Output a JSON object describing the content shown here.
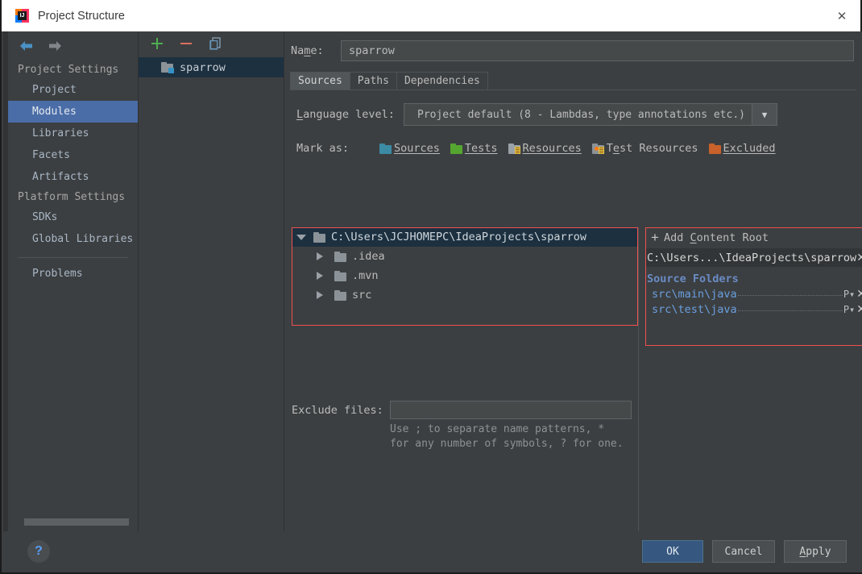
{
  "window": {
    "title": "Project Structure",
    "close_label": "✕",
    "app_icon_letter": "IJ"
  },
  "nav": {
    "back_icon": "arrow-left-icon",
    "forward_icon": "arrow-right-icon"
  },
  "sidebar": {
    "sections": [
      {
        "header": "Project Settings",
        "items": [
          {
            "label": "Project",
            "selected": false
          },
          {
            "label": "Modules",
            "selected": true
          },
          {
            "label": "Libraries",
            "selected": false
          },
          {
            "label": "Facets",
            "selected": false
          },
          {
            "label": "Artifacts",
            "selected": false
          }
        ]
      },
      {
        "header": "Platform Settings",
        "items": [
          {
            "label": "SDKs",
            "selected": false
          },
          {
            "label": "Global Libraries",
            "selected": false
          }
        ]
      }
    ],
    "footer_items": [
      {
        "label": "Problems",
        "selected": false
      }
    ]
  },
  "modules_panel": {
    "toolbar": [
      {
        "name": "add-module-button",
        "glyph": "+",
        "color": "#4caf50"
      },
      {
        "name": "remove-module-button",
        "glyph": "−",
        "color": "#d9705f"
      },
      {
        "name": "copy-module-button",
        "glyph": "copy",
        "color": "#6897bb"
      }
    ],
    "items": [
      {
        "label": "sparrow",
        "selected": true
      }
    ]
  },
  "main": {
    "name_label": "Name:",
    "name_label_mnemonic": "m",
    "name_value": "sparrow",
    "name_placeholder": "",
    "tabs": [
      {
        "label": "Sources",
        "active": true
      },
      {
        "label": "Paths",
        "active": false
      },
      {
        "label": "Dependencies",
        "active": false
      }
    ],
    "language_level": {
      "label": "Language level:",
      "label_mnemonic": "L",
      "value": "Project default (8 - Lambdas, type annotations etc.)",
      "arrow": "▼"
    },
    "mark_as": {
      "label": "Mark as:",
      "options": [
        {
          "label": "Sources",
          "mnemonic": "S",
          "color": "#3b8ba5",
          "style": "plain"
        },
        {
          "label": "Tests",
          "mnemonic": "T",
          "color": "#55a630",
          "style": "plain"
        },
        {
          "label": "Resources",
          "mnemonic": "R",
          "color": "#9aa2a8",
          "style": "lines"
        },
        {
          "label": "Test Resources",
          "mnemonic": "e",
          "color": "#55a630",
          "style": "lines-dot"
        },
        {
          "label": "Excluded",
          "mnemonic": "E",
          "color": "#c8622a",
          "style": "plain"
        }
      ]
    },
    "tree": {
      "rows": [
        {
          "label": "C:\\Users\\JCJHOMEPC\\IdeaProjects\\sparrow",
          "depth": 0,
          "expanded": true,
          "selected": true
        },
        {
          "label": ".idea",
          "depth": 1,
          "expanded": false,
          "selected": false
        },
        {
          "label": ".mvn",
          "depth": 1,
          "expanded": false,
          "selected": false
        },
        {
          "label": "src",
          "depth": 1,
          "expanded": false,
          "selected": false
        }
      ]
    },
    "content_roots": {
      "add_label": "Add Content Root",
      "add_mnemonic": "C",
      "add_icon": "plus-icon",
      "root_path": "C:\\Users...\\IdeaProjects\\sparrow",
      "root_remove_icon": "✕",
      "source_folders_title": "Source Folders",
      "source_folders": [
        {
          "path": "src\\main\\java",
          "package_prefix_icon": "P",
          "remove_icon": "✕"
        },
        {
          "path": "src\\test\\java",
          "package_prefix_icon": "P",
          "remove_icon": "✕"
        }
      ]
    },
    "exclude": {
      "label": "Exclude files:",
      "value": "",
      "placeholder": "",
      "hint_line1": "Use ; to separate name patterns, *",
      "hint_line2": "for any number of symbols, ? for one."
    }
  },
  "footer": {
    "help_icon": "?",
    "buttons": [
      {
        "label": "OK",
        "primary": true,
        "mnemonic": ""
      },
      {
        "label": "Cancel",
        "primary": false,
        "mnemonic": ""
      },
      {
        "label": "Apply",
        "primary": false,
        "mnemonic": "A"
      }
    ]
  },
  "colors": {
    "window_bg": "#3c3f41",
    "selection_blue": "#4a6da7",
    "tree_selection": "#1c3040",
    "highlight_red": "#f05050",
    "link_blue": "#6a9fe0",
    "primary_button": "#365880"
  }
}
